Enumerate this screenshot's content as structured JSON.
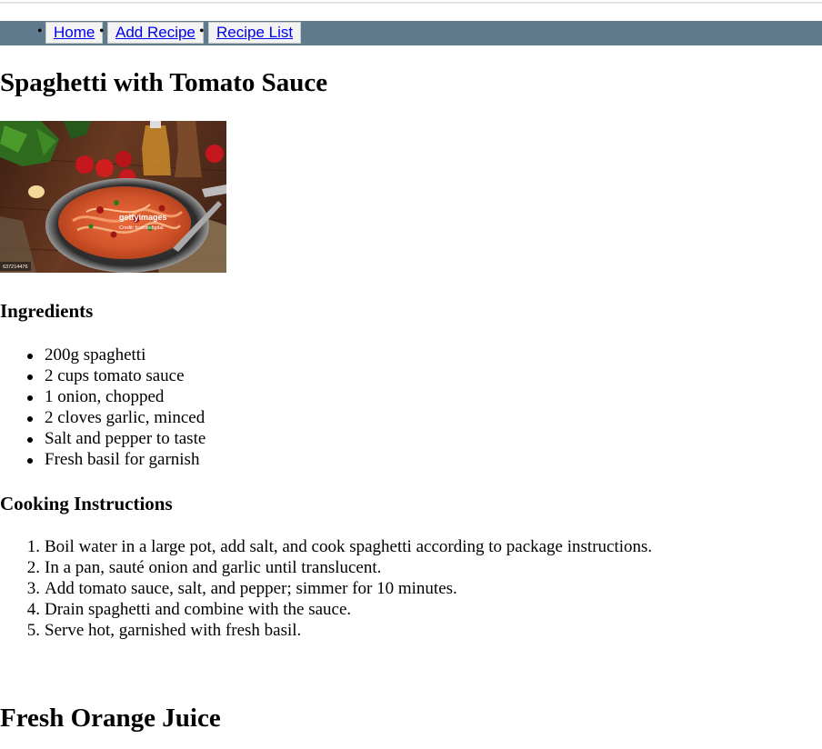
{
  "nav": {
    "items": [
      {
        "label": "Home"
      },
      {
        "label": "Add Recipe"
      },
      {
        "label": "Recipe List"
      }
    ]
  },
  "recipe1": {
    "title": "Spaghetti with Tomato Sauce",
    "photo": {
      "watermark_brand": "gettyimages",
      "watermark_credit": "Credit: fcafotodigital",
      "image_code": "637214476"
    },
    "ingredients_heading": "Ingredients",
    "ingredients": [
      "200g spaghetti",
      "2 cups tomato sauce",
      "1 onion, chopped",
      "2 cloves garlic, minced",
      "Salt and pepper to taste",
      "Fresh basil for garnish"
    ],
    "instructions_heading": "Cooking Instructions",
    "instructions": [
      {
        "num": "1.",
        "text": "Boil water in a large pot, add salt, and cook spaghetti according to package instructions."
      },
      {
        "num": "2.",
        "text": "In a pan, sauté onion and garlic until translucent."
      },
      {
        "num": "3.",
        "text": "Add tomato sauce, salt, and pepper; simmer for 10 minutes."
      },
      {
        "num": "4.",
        "text": "Drain spaghetti and combine with the sauce."
      },
      {
        "num": "5.",
        "text": "Serve hot, garnished with fresh basil."
      }
    ]
  },
  "recipe2": {
    "title": "Fresh Orange Juice"
  },
  "colors": {
    "navbar_bg": "#5f7a8c",
    "link": "#0000ee",
    "nav_button_bg": "#f3f3f3"
  }
}
